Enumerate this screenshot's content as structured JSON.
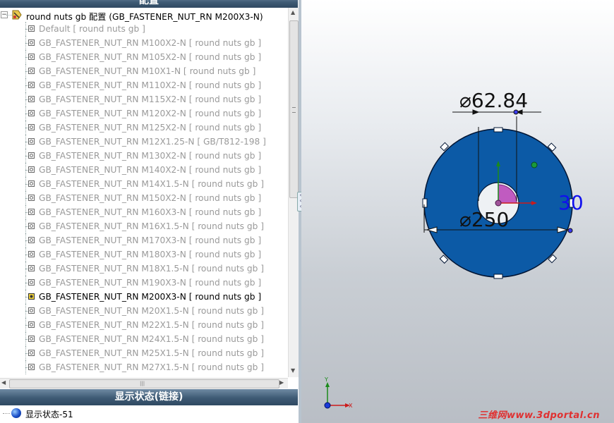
{
  "panel": {
    "title": "配置",
    "root_label": "round nuts gb 配置  (GB_FASTENER_NUT_RN M200X3-N)",
    "items": [
      {
        "label": "Default [ round nuts gb ]",
        "active": false
      },
      {
        "label": "GB_FASTENER_NUT_RN M100X2-N [ round nuts gb ]",
        "active": false
      },
      {
        "label": "GB_FASTENER_NUT_RN M105X2-N [ round nuts gb ]",
        "active": false
      },
      {
        "label": "GB_FASTENER_NUT_RN M10X1-N [ round nuts gb ]",
        "active": false
      },
      {
        "label": "GB_FASTENER_NUT_RN M110X2-N [ round nuts gb ]",
        "active": false
      },
      {
        "label": "GB_FASTENER_NUT_RN M115X2-N [ round nuts gb ]",
        "active": false
      },
      {
        "label": "GB_FASTENER_NUT_RN M120X2-N [ round nuts gb ]",
        "active": false
      },
      {
        "label": "GB_FASTENER_NUT_RN M125X2-N [ round nuts gb ]",
        "active": false
      },
      {
        "label": "GB_FASTENER_NUT_RN M12X1.25-N [ GB/T812-198 ]",
        "active": false
      },
      {
        "label": "GB_FASTENER_NUT_RN M130X2-N [ round nuts gb ]",
        "active": false
      },
      {
        "label": "GB_FASTENER_NUT_RN M140X2-N [ round nuts gb ]",
        "active": false
      },
      {
        "label": "GB_FASTENER_NUT_RN M14X1.5-N [ round nuts gb ]",
        "active": false
      },
      {
        "label": "GB_FASTENER_NUT_RN M150X2-N [ round nuts gb ]",
        "active": false
      },
      {
        "label": "GB_FASTENER_NUT_RN M160X3-N [ round nuts gb ]",
        "active": false
      },
      {
        "label": "GB_FASTENER_NUT_RN M16X1.5-N [ round nuts gb ]",
        "active": false
      },
      {
        "label": "GB_FASTENER_NUT_RN M170X3-N [ round nuts gb ]",
        "active": false
      },
      {
        "label": "GB_FASTENER_NUT_RN M180X3-N [ round nuts gb ]",
        "active": false
      },
      {
        "label": "GB_FASTENER_NUT_RN M18X1.5-N [ round nuts gb ]",
        "active": false
      },
      {
        "label": "GB_FASTENER_NUT_RN M190X3-N [ round nuts gb ]",
        "active": false
      },
      {
        "label": "GB_FASTENER_NUT_RN M200X3-N [ round nuts gb ]",
        "active": true
      },
      {
        "label": "GB_FASTENER_NUT_RN M20X1.5-N [ round nuts gb ]",
        "active": false
      },
      {
        "label": "GB_FASTENER_NUT_RN M22X1.5-N [ round nuts gb ]",
        "active": false
      },
      {
        "label": "GB_FASTENER_NUT_RN M24X1.5-N [ round nuts gb ]",
        "active": false
      },
      {
        "label": "GB_FASTENER_NUT_RN M25X1.5-N [ round nuts gb ]",
        "active": false
      },
      {
        "label": "GB_FASTENER_NUT_RN M27X1.5-N [ round nuts gb ]",
        "active": false
      }
    ]
  },
  "display_state": {
    "title": "显示状态(链接)",
    "item": "显示状态-51"
  },
  "dimensions": {
    "inner_diameter": "62.84",
    "outer_diameter": "250",
    "width": "30",
    "diameter_symbol": "⌀"
  },
  "triad": {
    "x": "X",
    "y": "Y"
  },
  "watermark": "三维网www.3dportal.cn",
  "colors": {
    "part_fill": "#0c5aa6",
    "dimension_text": "#111111",
    "width_dim_text": "#1010ee",
    "header_bg": "#3e5a74"
  },
  "icons": {
    "root": "configuration-root-icon",
    "item": "configuration-icon",
    "display": "display-state-sphere-icon"
  }
}
